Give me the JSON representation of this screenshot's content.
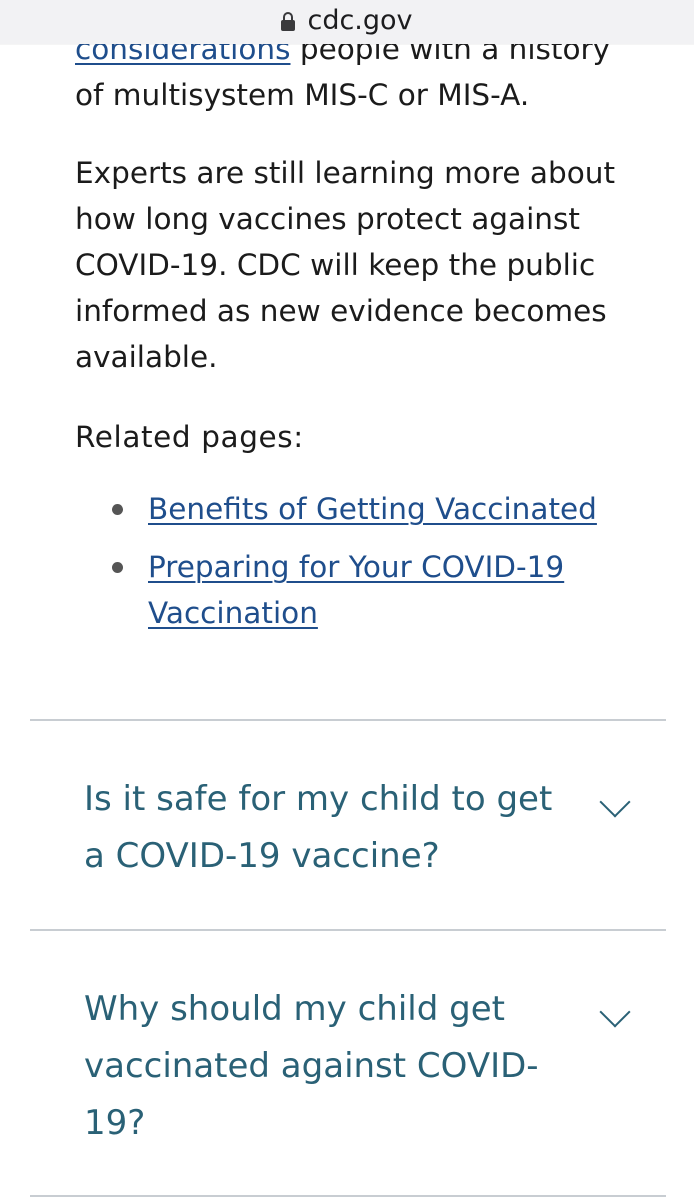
{
  "browser": {
    "url": "cdc.gov"
  },
  "article": {
    "para1_link": "considerations",
    "para1_rest": " people with a history of multisystem MIS-C or MIS-A.",
    "para2": "Experts are still learning more about how long vaccines protect against COVID-19. CDC will keep the public informed as new evidence becomes available.",
    "related_heading": "Related pages:",
    "related_links": [
      "Benefits of Getting Vaccinated",
      "Preparing for Your COVID-19 Vaccination"
    ]
  },
  "faq": {
    "items": [
      {
        "question": "Is it safe for my child to get a COVID-19 vaccine?"
      },
      {
        "question": "Why should my child get vaccinated against COVID-19?"
      }
    ]
  }
}
